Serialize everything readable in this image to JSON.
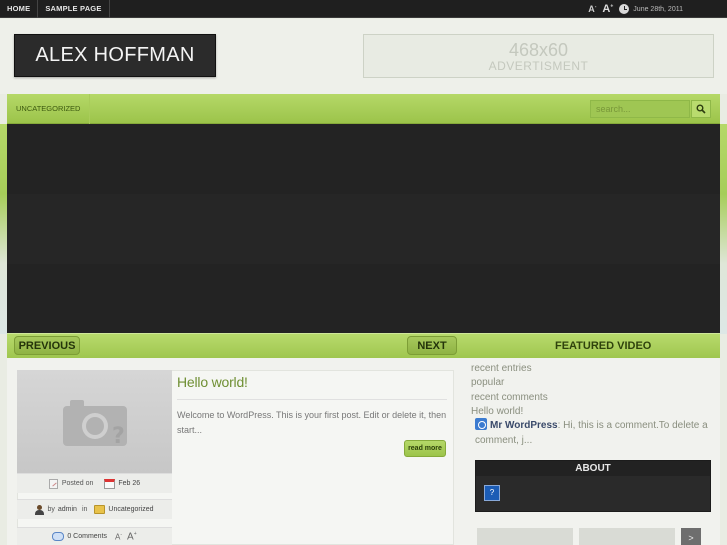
{
  "topnav": {
    "items": [
      "HOME",
      "SAMPLE PAGE"
    ],
    "font_small_label": "A",
    "font_large_label": "A",
    "font_sup": "+",
    "font_sup_minus": "-",
    "date": "June 28th, 2011"
  },
  "header": {
    "logo": "ALEX HOFFMAN",
    "ad_size": "468x60",
    "ad_label": "ADVERTISMENT"
  },
  "nav": {
    "category": "UNCATEGORIZED",
    "search_placeholder": "search..."
  },
  "slider": {
    "prev": "PREVIOUS",
    "next": "NEXT",
    "featured_title": "FEATURED VIDEO"
  },
  "post": {
    "title": "Hello world!",
    "excerpt": "Welcome to WordPress. This is your first post. Edit or delete it, then start...",
    "read_more": "read more",
    "posted_on_label": "Posted on",
    "date": "Feb 26",
    "by_label": "by",
    "author": "admin",
    "in_label": "in",
    "category": "Uncategorized",
    "comments": "0 Comments",
    "font_small": "A",
    "font_large": "A"
  },
  "sidebar": {
    "tabs": [
      "recent entries",
      "popular",
      "recent comments"
    ],
    "recent_post": "Hello world!",
    "comment_author": "Mr WordPress",
    "comment_text": ": Hi, this is a comment.To delete a comment, j...",
    "about_title": "ABOUT",
    "strip_next": ">"
  },
  "colors": {
    "accent_green": "#9cc44a",
    "dark_panel": "#232323",
    "post_title": "#6f8f33"
  }
}
